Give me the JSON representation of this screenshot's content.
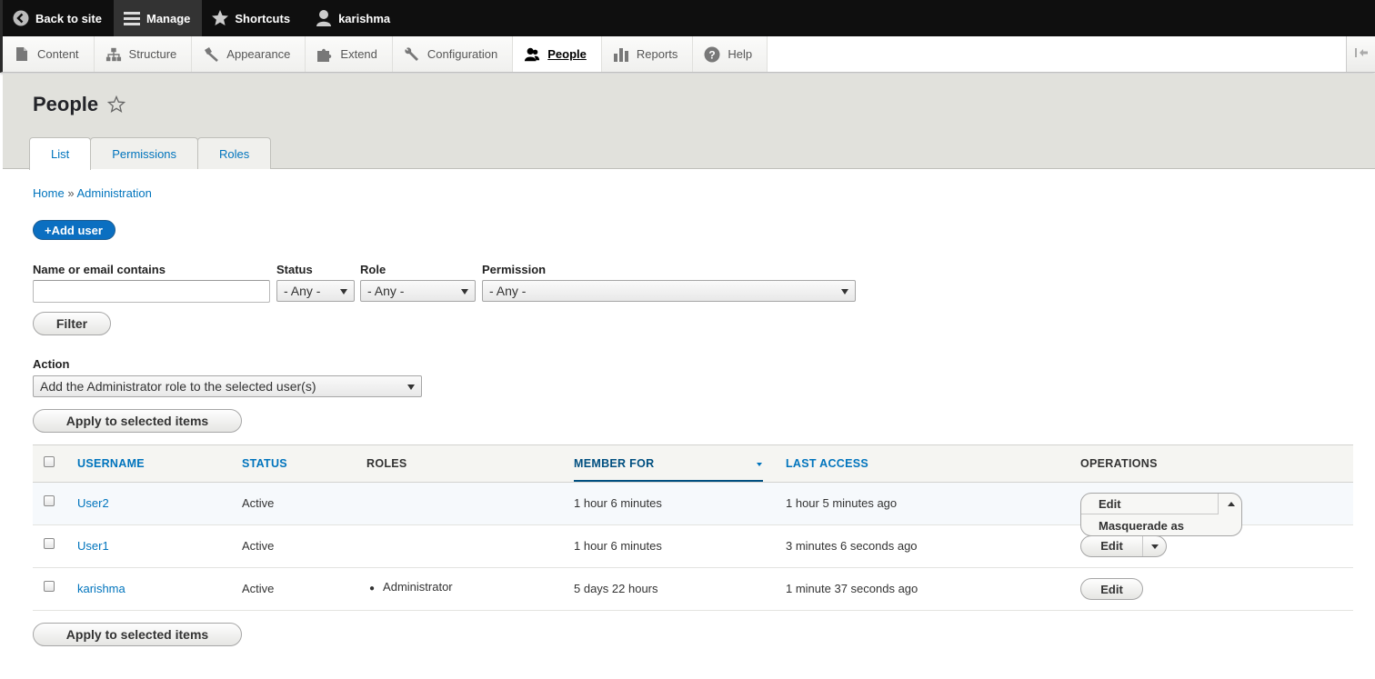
{
  "toolbar": {
    "back": "Back to site",
    "manage": "Manage",
    "shortcuts": "Shortcuts",
    "user": "karishma"
  },
  "tray": {
    "items": [
      {
        "label": "Content",
        "icon": "file-icon"
      },
      {
        "label": "Structure",
        "icon": "sitemap-icon"
      },
      {
        "label": "Appearance",
        "icon": "paintbrush-icon"
      },
      {
        "label": "Extend",
        "icon": "puzzle-icon"
      },
      {
        "label": "Configuration",
        "icon": "wrench-icon"
      },
      {
        "label": "People",
        "icon": "people-icon",
        "active": true
      },
      {
        "label": "Reports",
        "icon": "bar-chart-icon"
      },
      {
        "label": "Help",
        "icon": "help-icon"
      }
    ]
  },
  "page": {
    "title": "People",
    "tabs": [
      "List",
      "Permissions",
      "Roles"
    ],
    "active_tab": "List"
  },
  "breadcrumb": {
    "home": "Home",
    "sep": "»",
    "admin": "Administration"
  },
  "add_user": "+Add user",
  "filters": {
    "name_label": "Name or email contains",
    "name_value": "",
    "status_label": "Status",
    "status_value": "- Any -",
    "role_label": "Role",
    "role_value": "- Any -",
    "permission_label": "Permission",
    "permission_value": "- Any -",
    "filter_button": "Filter"
  },
  "action": {
    "label": "Action",
    "value": "Add the Administrator role to the selected user(s)",
    "apply": "Apply to selected items"
  },
  "table": {
    "headers": {
      "username": "USERNAME",
      "status": "STATUS",
      "roles": "ROLES",
      "member_for": "MEMBER FOR",
      "last_access": "LAST ACCESS",
      "operations": "OPERATIONS"
    },
    "rows": [
      {
        "username": "User2",
        "status": "Active",
        "roles": "",
        "member_for": "1 hour 6 minutes",
        "last_access": "1 hour 5 minutes ago",
        "op1": "Edit",
        "op2": "Masquerade as"
      },
      {
        "username": "User1",
        "status": "Active",
        "roles": "",
        "member_for": "1 hour 6 minutes",
        "last_access": "3 minutes 6 seconds ago",
        "op1": "Edit"
      },
      {
        "username": "karishma",
        "status": "Active",
        "roles": "Administrator",
        "member_for": "5 days 22 hours",
        "last_access": "1 minute 37 seconds ago",
        "op1": "Edit"
      }
    ]
  },
  "apply_bottom": "Apply to selected items"
}
